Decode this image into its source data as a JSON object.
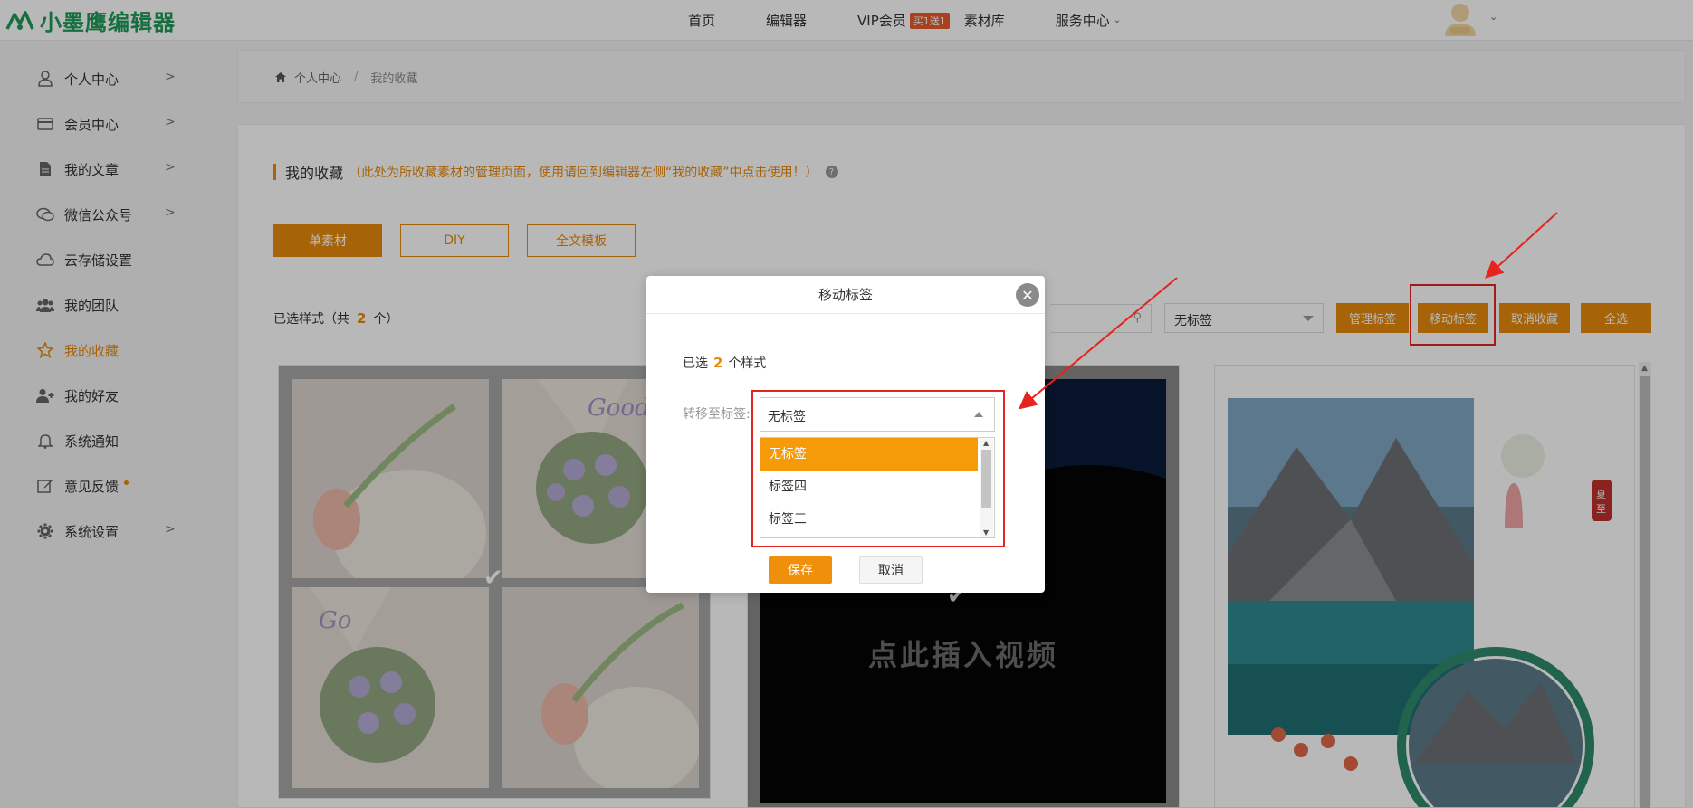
{
  "header": {
    "logo_text": "小墨鹰编辑器",
    "nav": [
      {
        "label": "首页"
      },
      {
        "label": "编辑器"
      },
      {
        "label": "VIP会员",
        "badge": "买1送1"
      },
      {
        "label": "素材库"
      },
      {
        "label": "服务中心"
      }
    ]
  },
  "sidebar": {
    "items": [
      {
        "label": "个人中心",
        "icon": "user-icon",
        "has_chevron": true
      },
      {
        "label": "会员中心",
        "icon": "card-icon",
        "has_chevron": true
      },
      {
        "label": "我的文章",
        "icon": "document-icon",
        "has_chevron": true
      },
      {
        "label": "微信公众号",
        "icon": "wechat-icon",
        "has_chevron": true
      },
      {
        "label": "云存储设置",
        "icon": "cloud-icon",
        "has_chevron": false
      },
      {
        "label": "我的团队",
        "icon": "team-icon",
        "has_chevron": false
      },
      {
        "label": "我的收藏",
        "icon": "star-icon",
        "has_chevron": false,
        "active": true
      },
      {
        "label": "我的好友",
        "icon": "add-friend-icon",
        "has_chevron": false
      },
      {
        "label": "系统通知",
        "icon": "bell-icon",
        "has_chevron": false
      },
      {
        "label": "意见反馈",
        "icon": "edit-icon",
        "has_chevron": false,
        "dot": true
      },
      {
        "label": "系统设置",
        "icon": "gear-icon",
        "has_chevron": true
      }
    ]
  },
  "breadcrumb": {
    "home": "个人中心",
    "separator": "/",
    "current": "我的收藏"
  },
  "main": {
    "title": "我的收藏",
    "note": "（此处为所收藏素材的管理页面，使用请回到编辑器左侧“我的收藏”中点击使用！）",
    "tabs": [
      "单素材",
      "DIY",
      "全文模板"
    ],
    "selected_prefix": "已选样式（共",
    "selected_count": "2",
    "selected_suffix": "个）",
    "tag_filter": "无标签",
    "actions": [
      "管理标签",
      "移动标签",
      "取消收藏",
      "全选"
    ],
    "video_placeholder": "点此插入视频",
    "season_tag": "夏至"
  },
  "modal": {
    "title": "移动标签",
    "selected_prefix": "已选",
    "selected_count": "2",
    "selected_suffix": "个样式",
    "transfer_label": "转移至标签:",
    "current_value": "无标签",
    "options": [
      "无标签",
      "标签四",
      "标签三"
    ],
    "save": "保存",
    "cancel": "取消"
  },
  "colors": {
    "accent": "#e8890b",
    "brand_green": "#1e9a57",
    "highlight_red": "#e5231f"
  }
}
